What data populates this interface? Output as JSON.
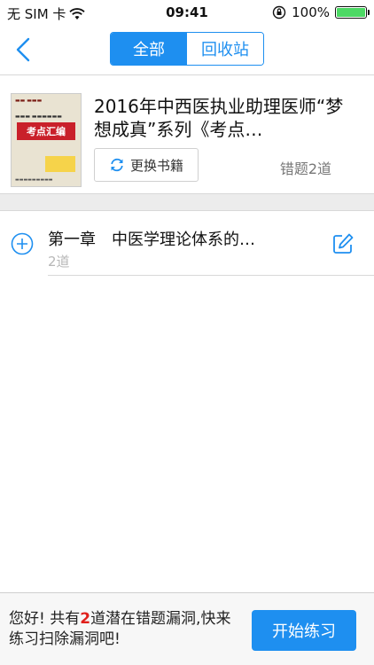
{
  "status_bar": {
    "carrier": "无 SIM 卡",
    "time": "09:41",
    "battery_text": "100%",
    "battery_level": 1.0,
    "battery_color": "#4cd964"
  },
  "nav": {
    "tabs": [
      {
        "label": "全部",
        "active": true
      },
      {
        "label": "回收站",
        "active": false
      }
    ],
    "accent_color": "#1e8ff0"
  },
  "book": {
    "title": "2016年中西医执业助理医师“梦想成真”系列《考点…",
    "change_button_label": "更换书籍",
    "wrong_count": "错题2道",
    "cover_band_text": "考点汇编"
  },
  "chapters": [
    {
      "title": "第一章　中医学理论体系的…",
      "count": "2道"
    }
  ],
  "footer": {
    "message_prefix": "您好! 共有",
    "message_number": "2",
    "message_suffix": "道潜在错题漏洞,快来练习扫除漏洞吧!",
    "start_button_label": "开始练习"
  }
}
